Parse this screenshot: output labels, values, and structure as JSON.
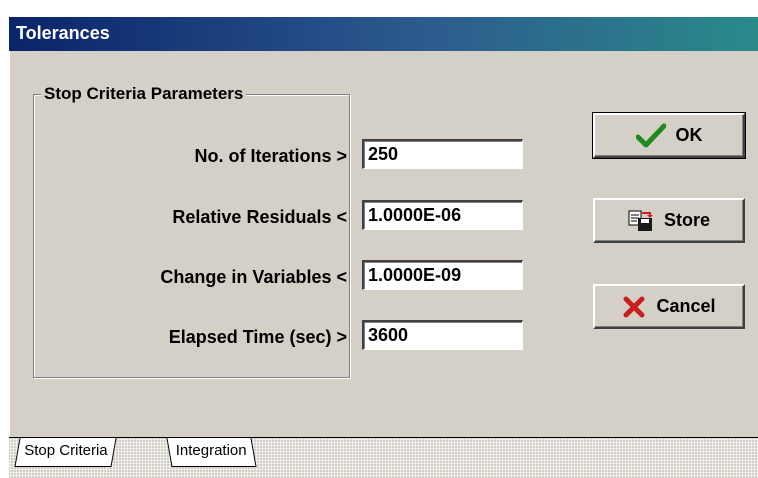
{
  "window": {
    "title": "Tolerances"
  },
  "group": {
    "title": "Stop Criteria Parameters"
  },
  "params": [
    {
      "label": "No. of Iterations >",
      "value": "250"
    },
    {
      "label": "Relative Residuals <",
      "value": "1.0000E-06"
    },
    {
      "label": "Change in Variables <",
      "value": "1.0000E-09"
    },
    {
      "label": "Elapsed Time (sec) >",
      "value": "3600"
    }
  ],
  "buttons": {
    "ok": {
      "label": "OK",
      "icon": "checkmark-icon"
    },
    "store": {
      "label": "Store",
      "icon": "store-icon"
    },
    "cancel": {
      "label": "Cancel",
      "icon": "x-icon"
    }
  },
  "tabs": [
    {
      "label": "Stop Criteria",
      "active": true
    },
    {
      "label": "Integration",
      "active": false
    }
  ]
}
